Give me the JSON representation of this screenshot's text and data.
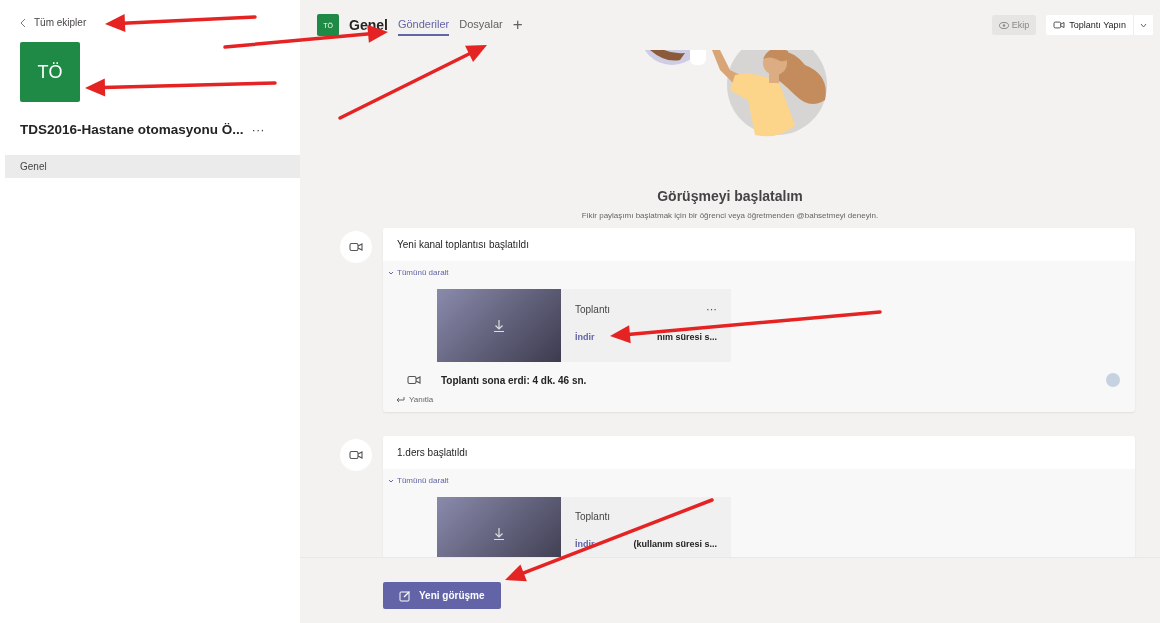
{
  "sidebar": {
    "back_link": "Tüm ekipler",
    "team_avatar": "TÖ",
    "team_name": "TDS2016-Hastane otomasyonu Ö...",
    "more": "···",
    "channels": [
      {
        "label": "Genel",
        "selected": true
      }
    ]
  },
  "header": {
    "avatar": "TÖ",
    "channel": "Genel",
    "tabs": [
      {
        "label": "Gönderiler",
        "selected": true
      },
      {
        "label": "Dosyalar",
        "selected": false
      }
    ],
    "add_tab": "+",
    "team_button": "Ekip",
    "meet_button": "Toplantı Yapın"
  },
  "welcome": {
    "title": "Görüşmeyi başlatalım",
    "subtitle": "Fikir paylaşımı başlatmak için bir öğrenci veya öğretmenden @bahsetmeyi deneyin."
  },
  "posts": [
    {
      "title": "Yeni kanal toplantısı başlatıldı",
      "collapse": "Tümünü daralt",
      "recording": {
        "title": "Toplantı",
        "more": "···",
        "download": "İndir",
        "detail": "nım süresi s..."
      },
      "ended": "Toplantı sona erdi: 4 dk. 46 sn.",
      "reply": "Yanıtla"
    },
    {
      "title": "1.ders başlatıldı",
      "collapse": "Tümünü daralt",
      "recording": {
        "title": "Toplantı",
        "download": "İndir",
        "detail": "(kullanım süresi s..."
      }
    }
  ],
  "compose_button": "Yeni görüşme"
}
